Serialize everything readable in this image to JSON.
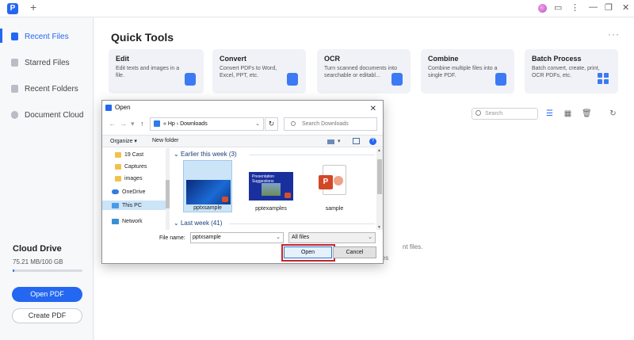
{
  "titlebar": {
    "logo_glyph": "P",
    "new_tab": "+",
    "icons": [
      "message-icon",
      "minimize-icon",
      "restore-icon",
      "close-icon"
    ]
  },
  "sidebar": {
    "items": [
      {
        "label": "Recent Files",
        "icon": "recent-files-icon"
      },
      {
        "label": "Starred Files",
        "icon": "star-icon"
      },
      {
        "label": "Recent Folders",
        "icon": "folder-icon"
      },
      {
        "label": "Document Cloud",
        "icon": "cloud-icon"
      }
    ],
    "cloud_drive_title": "Cloud Drive",
    "cloud_drive_usage": "75.21 MB/100 GB",
    "cloud_usage_fraction": 0.01,
    "open_pdf": "Open PDF",
    "create_pdf": "Create PDF"
  },
  "quick_tools": {
    "title": "Quick Tools",
    "more": "···",
    "cards": [
      {
        "title": "Edit",
        "desc": "Edit texts and images in a file."
      },
      {
        "title": "Convert",
        "desc": "Convert PDFs to Word, Excel, PPT, etc."
      },
      {
        "title": "OCR",
        "desc": "Turn scanned documents into searchable or editabl..."
      },
      {
        "title": "Combine",
        "desc": "Combine multiple files into a single PDF."
      },
      {
        "title": "Batch Process",
        "desc": "Batch convert, create, print, OCR PDFs, etc."
      }
    ]
  },
  "files_toolbar": {
    "search_placeholder": "Search"
  },
  "background_text": {
    "nt_files": "nt files.",
    "les": "les"
  },
  "dialog": {
    "title": "Open",
    "close": "✕",
    "breadcrumb": [
      "«",
      "Hp",
      "›",
      "Downloads"
    ],
    "search_placeholder": "Search Downloads",
    "organize": "Organize ▾",
    "new_folder": "New folder",
    "nav_items": [
      {
        "label": "19 Cast",
        "type": "folder"
      },
      {
        "label": "Captures",
        "type": "folder"
      },
      {
        "label": "images",
        "type": "folder"
      },
      {
        "label": "OneDrive",
        "type": "onedrive"
      },
      {
        "label": "This PC",
        "type": "pc"
      },
      {
        "label": "Network",
        "type": "network"
      }
    ],
    "groups": [
      {
        "label": "Earlier this week (3)"
      },
      {
        "label": "Last week (41)"
      }
    ],
    "files": [
      {
        "name": "pptxsample"
      },
      {
        "name": "pptexamples",
        "thumb_title": "Presentation Suggestions"
      },
      {
        "name": "sample"
      }
    ],
    "file_name_label": "File name:",
    "file_name_value": "pptxsample",
    "file_type": "All files",
    "open_button": "Open",
    "cancel_button": "Cancel"
  },
  "colors": {
    "accent": "#2467f0",
    "highlight_outline": "#c4262e"
  }
}
